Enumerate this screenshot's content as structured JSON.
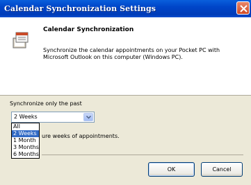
{
  "window": {
    "title": "Calendar Synchronization Settings"
  },
  "header": {
    "title": "Calendar Synchronization",
    "description": "Synchronize the calendar appointments on your Pocket PC with Microsoft Outlook on this computer (Windows PC)."
  },
  "sync": {
    "label": "Synchronize only the past",
    "selected": "2 Weeks",
    "options": [
      "All",
      "2 Weeks",
      "1 Month",
      "3 Months",
      "6 Months"
    ],
    "future_text": "ure weeks of appointments."
  },
  "buttons": {
    "ok": "OK",
    "cancel": "Cancel"
  },
  "colors": {
    "titlebar": "#0045c8",
    "selection": "#316ac5",
    "close": "#d04a24"
  },
  "icons": {
    "app": "calendar-sync-icon",
    "close": "close-icon",
    "dropdown": "chevron-down-icon"
  }
}
